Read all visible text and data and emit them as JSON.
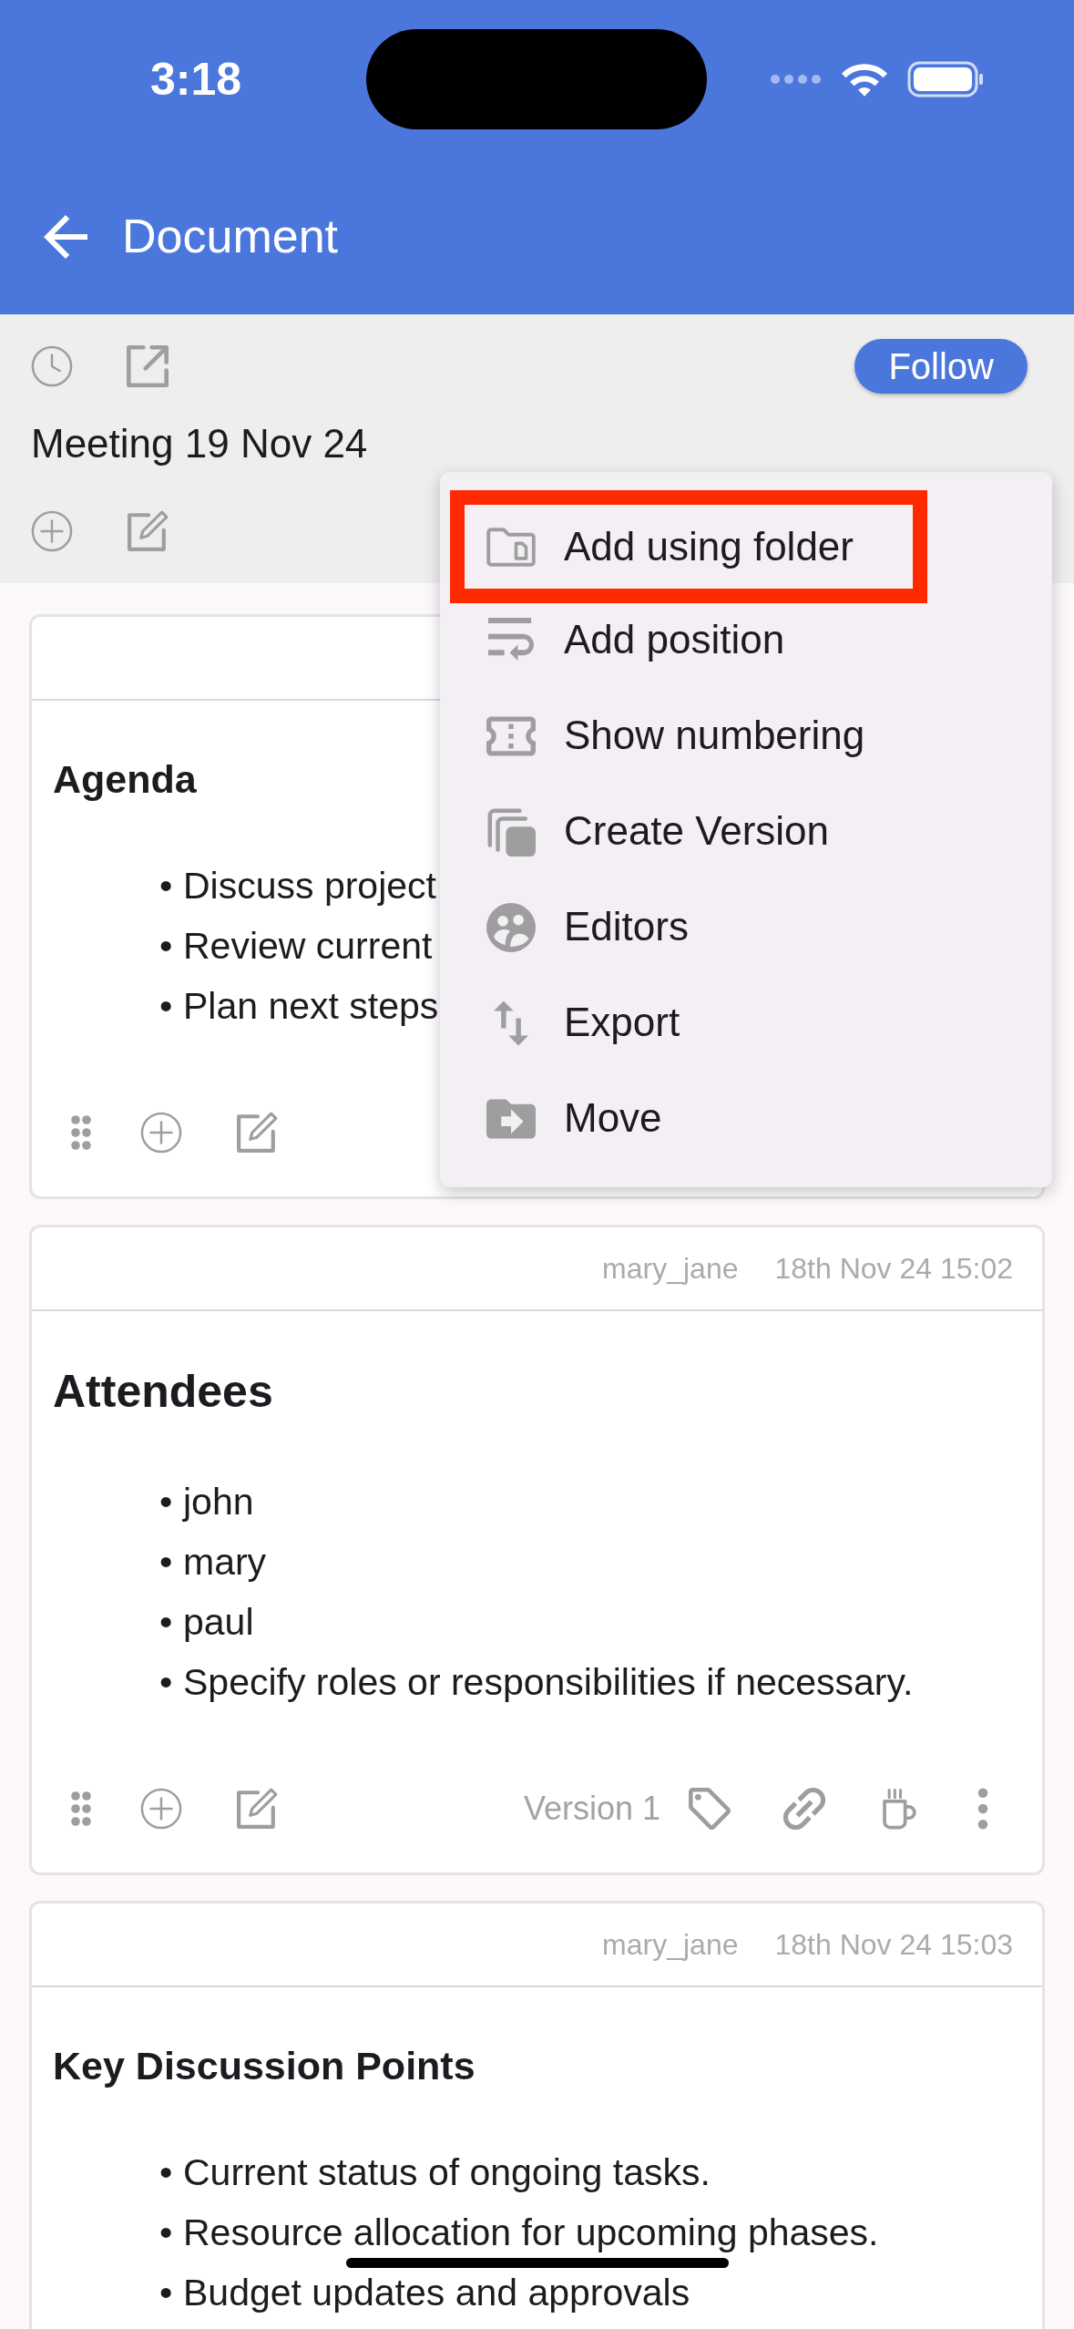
{
  "status_bar": {
    "time": "3:18"
  },
  "app_bar": {
    "title": "Document"
  },
  "document": {
    "title": "Meeting 19 Nov 24",
    "follow_button": "Follow"
  },
  "cards": [
    {
      "heading": {
        "text": "Agenda",
        "kind": "medium"
      },
      "bullets": [
        {
          "marker": "•",
          "text": "Discuss project"
        },
        {
          "marker": "•",
          "text": "Review current"
        },
        {
          "marker": "•",
          "text": "Plan next steps"
        }
      ],
      "footer": {
        "kind": "basic"
      }
    },
    {
      "author": "mary_jane",
      "timestamp": "18th Nov 24 15:02",
      "heading": {
        "text": "Attendees",
        "kind": "large"
      },
      "bullets": [
        {
          "marker": "•",
          "text": "john"
        },
        {
          "marker": "•",
          "text": "mary"
        },
        {
          "marker": "•",
          "text": "paul"
        },
        {
          "marker": "•",
          "text": "Specify roles or responsibilities if necessary."
        }
      ],
      "footer": {
        "kind": "full",
        "version": "Version 1"
      }
    },
    {
      "author": "mary_jane",
      "timestamp": "18th Nov 24 15:03",
      "heading": {
        "text": "Key Discussion Points",
        "kind": "medium"
      },
      "bullets": [
        {
          "marker": "•",
          "text": "Current status of ongoing tasks."
        },
        {
          "marker": "•",
          "text": "Resource allocation for upcoming phases."
        },
        {
          "marker": "•",
          "text": "Budget updates and approvals"
        }
      ]
    }
  ],
  "menu": {
    "items": [
      {
        "label": "Add using folder",
        "highlighted": true
      },
      {
        "label": "Add position",
        "highlighted": false
      },
      {
        "label": "Show numbering",
        "highlighted": false
      },
      {
        "label": "Create Version",
        "highlighted": false
      },
      {
        "label": "Editors",
        "highlighted": false
      },
      {
        "label": "Export",
        "highlighted": false
      },
      {
        "label": "Move",
        "highlighted": false
      }
    ]
  }
}
